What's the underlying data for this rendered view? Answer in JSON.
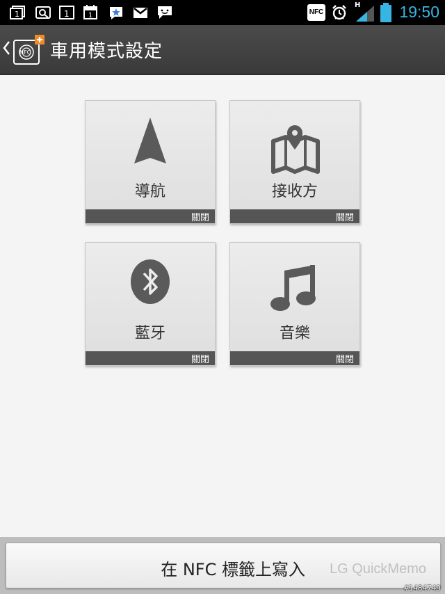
{
  "status_bar": {
    "time": "19:50",
    "nfc_label": "NFC",
    "network_type": "H",
    "icons": [
      "recent-apps-icon",
      "quickmemo-icon",
      "calendar-1-icon",
      "calendar-icon",
      "sns-star-icon",
      "gmail-icon",
      "message-icon",
      "nfc-icon",
      "alarm-icon",
      "signal-icon",
      "battery-icon"
    ],
    "time_color": "#38b6e3"
  },
  "action_bar": {
    "title": "車用模式設定",
    "logo_text": "NFC"
  },
  "tiles": [
    {
      "label": "導航",
      "status": "關閉",
      "icon": "navigation-arrow-icon"
    },
    {
      "label": "接收方",
      "status": "關閉",
      "icon": "map-pin-icon"
    },
    {
      "label": "藍牙",
      "status": "關閉",
      "icon": "bluetooth-icon"
    },
    {
      "label": "音樂",
      "status": "關閉",
      "icon": "music-note-icon"
    }
  ],
  "bottom": {
    "button_label": "在 NFC 標籤上寫入",
    "watermark": "LG QuickMemo",
    "image_id": "#1484749"
  }
}
